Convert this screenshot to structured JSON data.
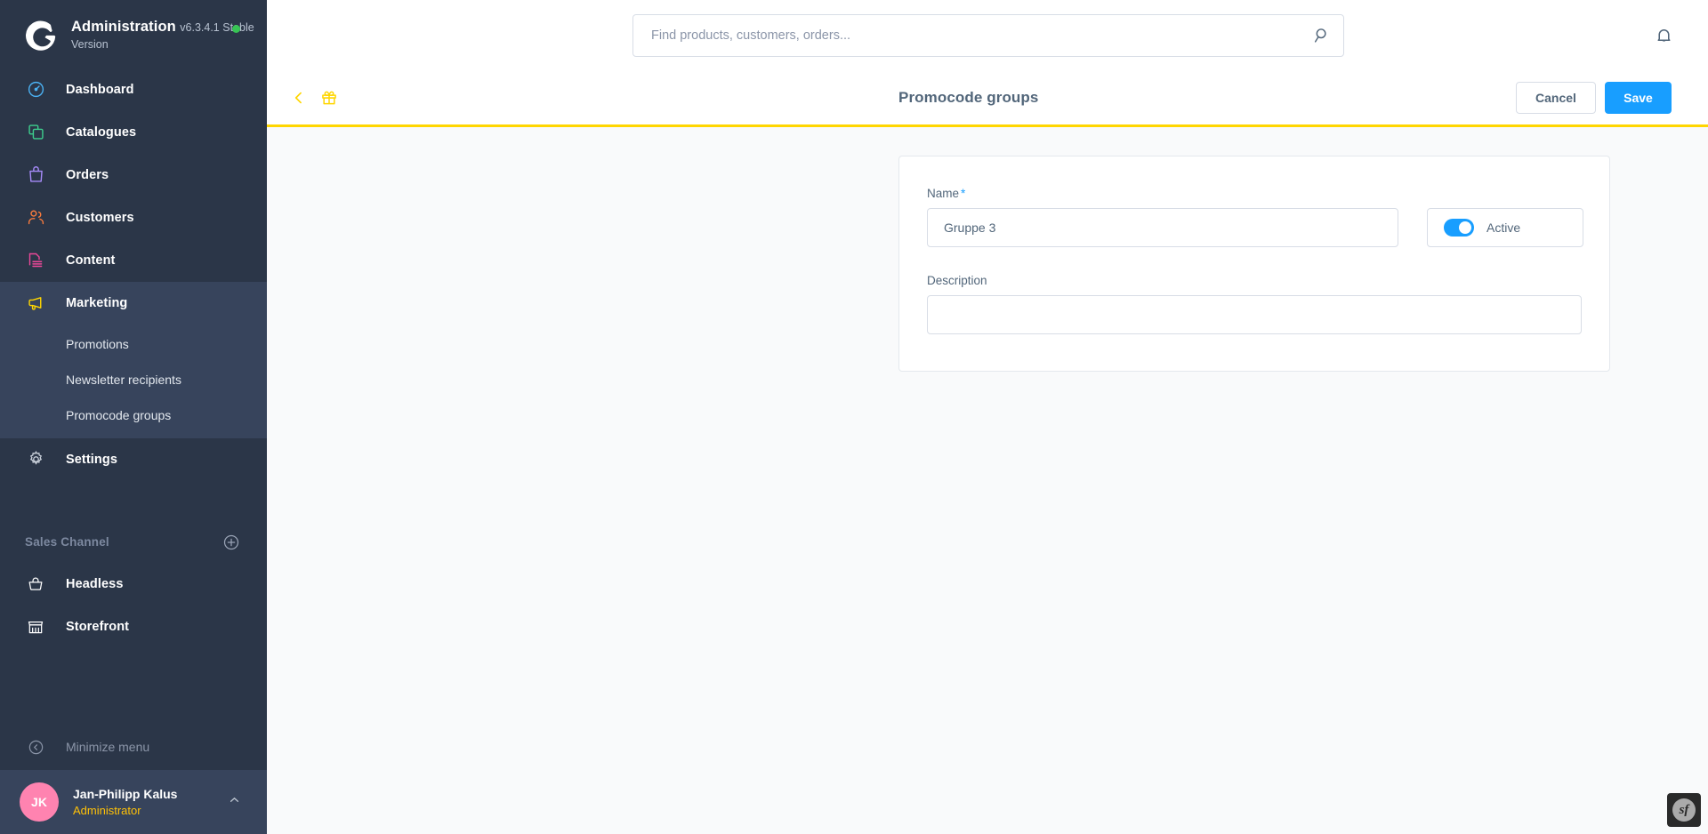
{
  "sidebar": {
    "brand": {
      "title": "Administration",
      "version": "v6.3.4.1 Stable Version",
      "logo_icon": "shopware-logo-icon",
      "status_icon": "status-online-dot"
    },
    "nav": [
      {
        "label": "Dashboard",
        "icon": "speedometer-icon",
        "color": "#4bb3f5",
        "active": false
      },
      {
        "label": "Catalogues",
        "icon": "layers-copy-icon",
        "color": "#3ecf8e",
        "active": false
      },
      {
        "label": "Orders",
        "icon": "shopping-bag-icon",
        "color": "#a78bfa",
        "active": false
      },
      {
        "label": "Customers",
        "icon": "users-icon",
        "color": "#f97b3d",
        "active": false
      },
      {
        "label": "Content",
        "icon": "content-page-icon",
        "color": "#ec4899",
        "active": false
      },
      {
        "label": "Marketing",
        "icon": "megaphone-icon",
        "color": "#ffd600",
        "active": true
      }
    ],
    "submenu": [
      {
        "label": "Promotions"
      },
      {
        "label": "Newsletter recipients"
      },
      {
        "label": "Promocode groups"
      }
    ],
    "settings": {
      "label": "Settings",
      "icon": "gear-icon",
      "color": "#c9d0da"
    },
    "sales_channel": {
      "title": "Sales Channel",
      "add_icon": "plus-circle-icon",
      "items": [
        {
          "label": "Headless",
          "icon": "basket-icon"
        },
        {
          "label": "Storefront",
          "icon": "storefront-icon"
        }
      ]
    },
    "minimize": {
      "label": "Minimize menu",
      "icon": "chevron-left-circle-icon"
    },
    "user": {
      "initials": "JK",
      "name": "Jan-Philipp Kalus",
      "role": "Administrator",
      "avatar_color": "#ff83b0",
      "chevron_icon": "chevron-up-icon"
    }
  },
  "topbar": {
    "search": {
      "placeholder": "Find products, customers, orders...",
      "value": "",
      "icon": "search-icon"
    },
    "notifications_icon": "bell-icon"
  },
  "pagehead": {
    "back_icon": "chevron-left-icon",
    "module_icon": "gift-icon",
    "title": "Promocode groups",
    "cancel_label": "Cancel",
    "save_label": "Save",
    "accent_color": "#ffd600",
    "primary_color": "#189eff"
  },
  "form": {
    "name": {
      "label": "Name",
      "required_marker": "*",
      "value": "Gruppe 3",
      "placeholder": ""
    },
    "active": {
      "label": "Active",
      "enabled": true
    },
    "description": {
      "label": "Description",
      "value": "",
      "placeholder": ""
    }
  },
  "debug_toolbar": {
    "label": "sf",
    "icon": "symfony-profiler-icon"
  }
}
